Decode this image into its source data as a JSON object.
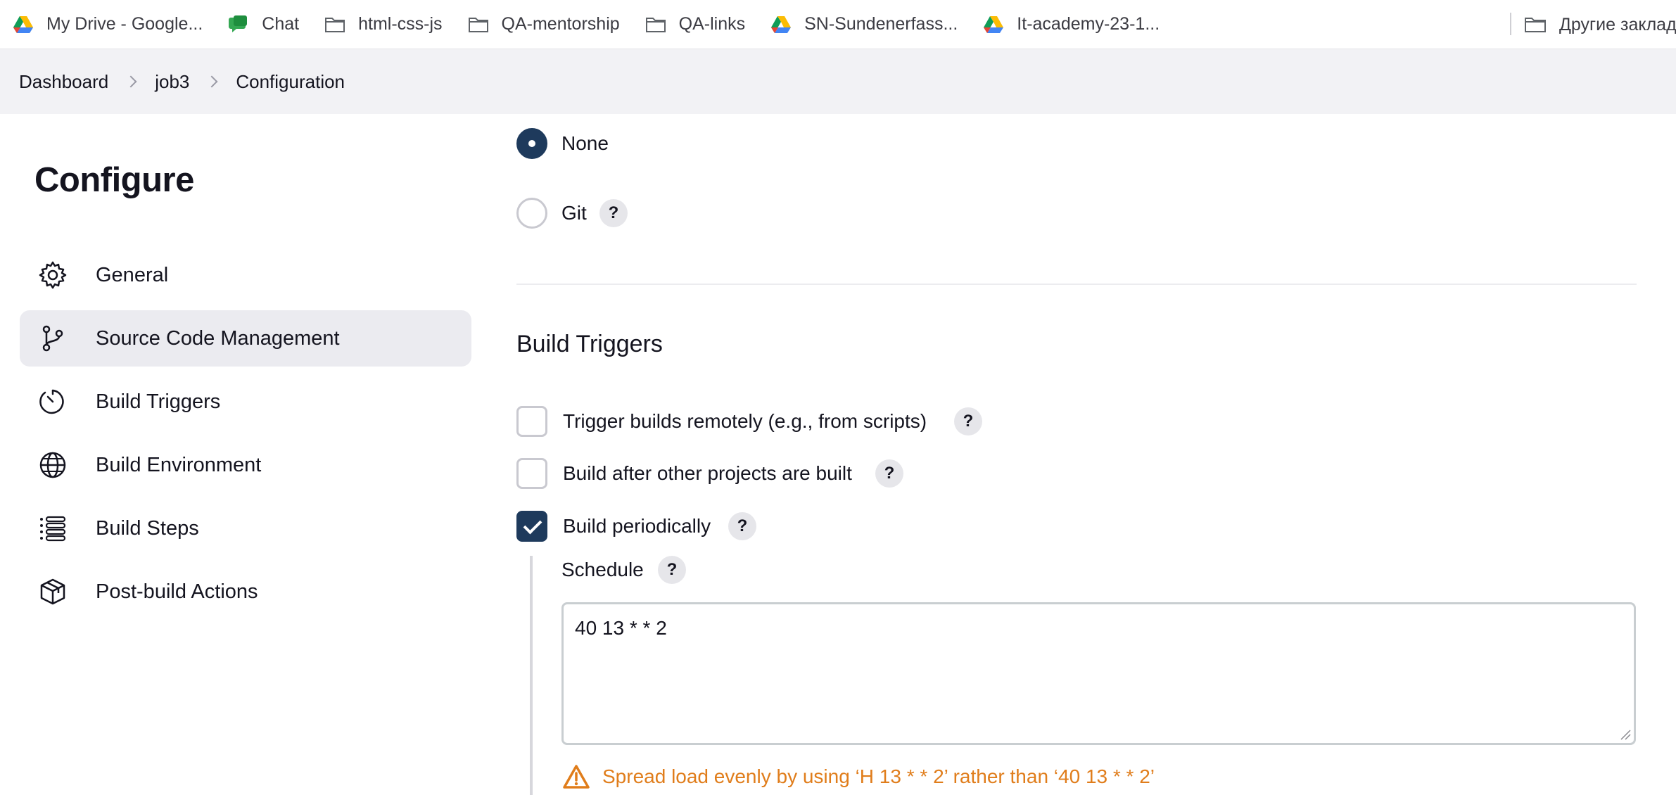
{
  "bookmarks": {
    "items": [
      {
        "label": "My Drive - Google...",
        "icon": "google-drive-icon"
      },
      {
        "label": "Chat",
        "icon": "chat-icon"
      },
      {
        "label": "html-css-js",
        "icon": "folder-icon"
      },
      {
        "label": "QA-mentorship",
        "icon": "folder-icon"
      },
      {
        "label": "QA-links",
        "icon": "folder-icon"
      },
      {
        "label": "SN-Sundenerfass...",
        "icon": "google-drive-icon"
      },
      {
        "label": "It-academy-23-1...",
        "icon": "google-drive-icon"
      }
    ],
    "other": "Другие заклад"
  },
  "breadcrumb": {
    "items": [
      "Dashboard",
      "job3",
      "Configuration"
    ]
  },
  "sidebar": {
    "title": "Configure",
    "items": [
      {
        "label": "General",
        "icon": "gear-icon",
        "active": false
      },
      {
        "label": "Source Code Management",
        "icon": "branch-icon",
        "active": true
      },
      {
        "label": "Build Triggers",
        "icon": "clock-icon",
        "active": false
      },
      {
        "label": "Build Environment",
        "icon": "globe-icon",
        "active": false
      },
      {
        "label": "Build Steps",
        "icon": "list-icon",
        "active": false
      },
      {
        "label": "Post-build Actions",
        "icon": "package-icon",
        "active": false
      }
    ]
  },
  "scm": {
    "options": [
      {
        "label": "None",
        "selected": true
      },
      {
        "label": "Git",
        "selected": false,
        "help": "?"
      }
    ]
  },
  "build_triggers": {
    "title": "Build Triggers",
    "options": [
      {
        "label": "Trigger builds remotely (e.g., from scripts)",
        "checked": false,
        "help": "?"
      },
      {
        "label": "Build after other projects are built",
        "checked": false,
        "help": "?"
      },
      {
        "label": "Build periodically",
        "checked": true,
        "help": "?"
      }
    ],
    "schedule": {
      "label": "Schedule",
      "help": "?",
      "value": "40 13 * * 2"
    },
    "warning": "Spread load evenly by using ‘H 13 * * 2’ rather than ‘40 13 * * 2’"
  },
  "colors": {
    "accent": "#1e3a5c",
    "warning": "#e07d1b",
    "sidebar_active_bg": "#ebebf0",
    "breadcrumb_bg": "#f2f2f5"
  }
}
